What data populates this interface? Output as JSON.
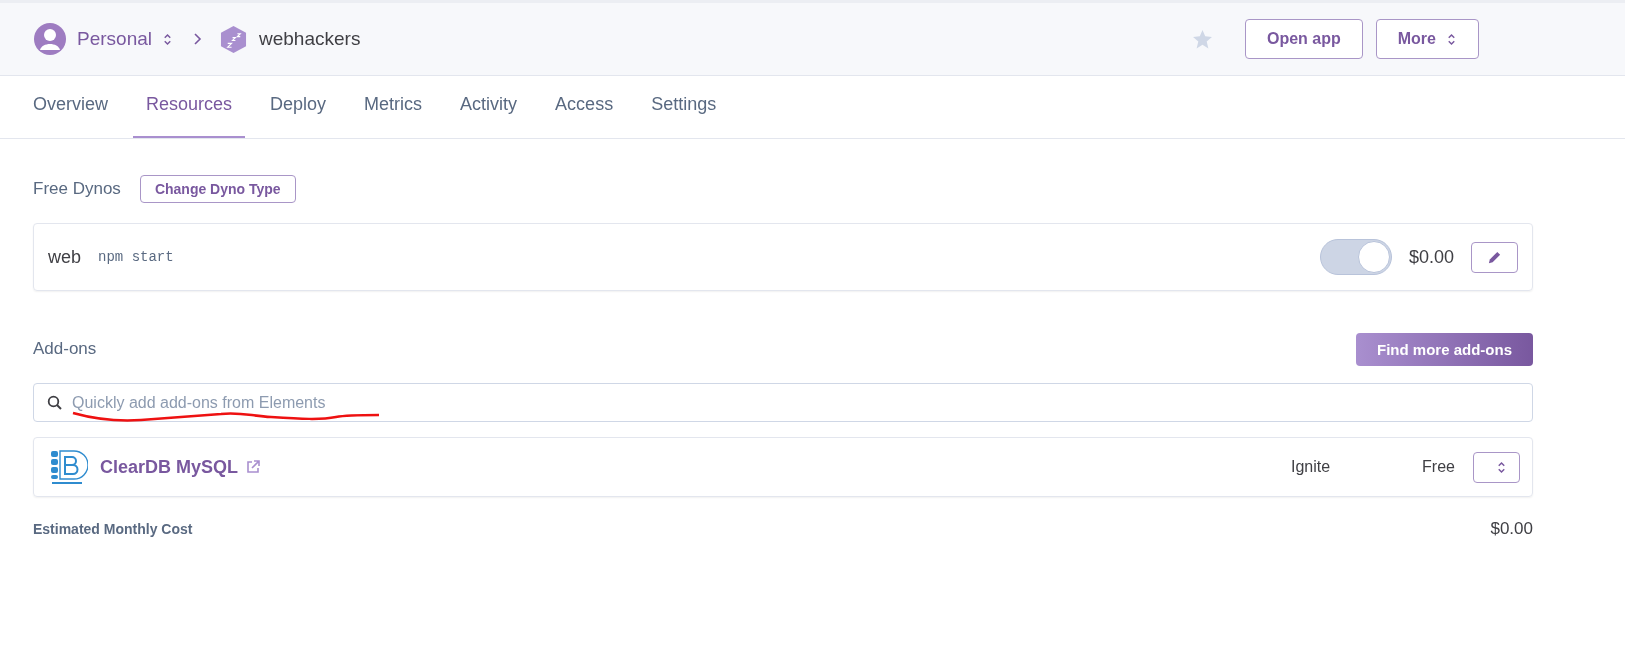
{
  "header": {
    "breadcrumb": [
      {
        "kind": "account",
        "label": "Personal"
      },
      {
        "kind": "app",
        "label": "webhackers"
      }
    ],
    "favorite": false,
    "buttons": [
      {
        "kind": "plain",
        "label": "Open app"
      },
      {
        "kind": "dropdown",
        "label": "More"
      }
    ]
  },
  "tabs": [
    {
      "label": "Overview",
      "selected": false
    },
    {
      "label": "Resources",
      "selected": true
    },
    {
      "label": "Deploy",
      "selected": false
    },
    {
      "label": "Metrics",
      "selected": false
    },
    {
      "label": "Activity",
      "selected": false
    },
    {
      "label": "Access",
      "selected": false
    },
    {
      "label": "Settings",
      "selected": false
    }
  ],
  "dynos": {
    "title": "Free Dynos",
    "button": "Change Dyno Type",
    "items": [
      {
        "name": "web",
        "command": "npm start",
        "on": true,
        "price": "$0.00"
      }
    ]
  },
  "addons": {
    "title": "Add-ons",
    "button": "Find more add-ons",
    "search": {
      "placeholder": "Quickly add add-ons from Elements"
    },
    "items": [
      {
        "name": "ClearDB MySQL",
        "plan": "Ignite",
        "price": "Free"
      }
    ],
    "total_label": "Estimated Monthly Cost",
    "total": "$0.00"
  },
  "annotations": [
    {
      "kind": "underline"
    }
  ]
}
